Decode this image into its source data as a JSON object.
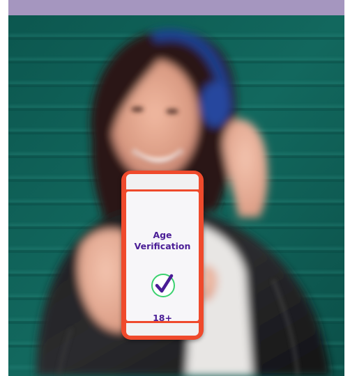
{
  "header_band": {
    "color": "#a596bf"
  },
  "photo": {
    "subject": "woman-with-headphones",
    "background_color": "#0f5d55"
  },
  "phone": {
    "frame_color": "#ef4a2c",
    "screen": {
      "title_line1": "Age",
      "title_line2": "Verification",
      "icon": "check-circle-icon",
      "check_color": "#4a1d96",
      "ring_color": "#3bd16f",
      "age_label": "18+"
    }
  }
}
